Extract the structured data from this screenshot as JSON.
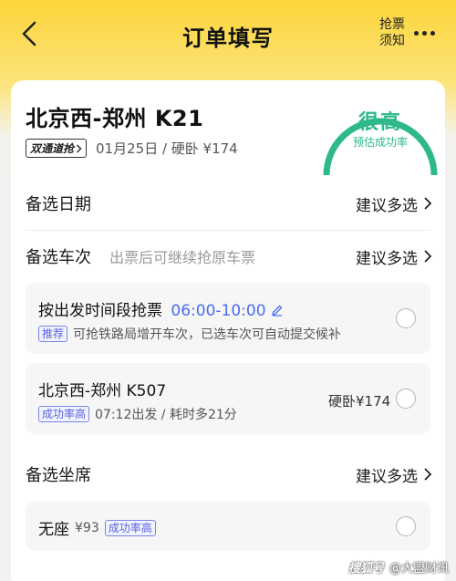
{
  "nav": {
    "title": "订单填写",
    "notice_line1": "抢票",
    "notice_line2": "须知"
  },
  "train": {
    "route": "北京西-郑州 K21",
    "tag": "双通道抢",
    "info": "01月25日 / 硬卧 ¥174"
  },
  "success_gauge": {
    "value": "很高",
    "label": "预估成功率",
    "color": "#2fb88c"
  },
  "alt_date": {
    "label": "备选日期",
    "action": "建议多选"
  },
  "alt_train": {
    "label": "备选车次",
    "hint": "出票后可继续抢原车票",
    "action": "建议多选",
    "options": [
      {
        "title": "按出发时间段抢票",
        "time_range": "06:00-10:00",
        "badge": "推荐",
        "desc": "可抢铁路局增开车次，已选车次可自动提交候补"
      },
      {
        "title": "北京西-郑州 K507",
        "badge": "成功率高",
        "desc": "07:12出发 / 耗时多21分",
        "price": "硬卧¥174"
      }
    ]
  },
  "alt_seat": {
    "label": "备选坐席",
    "action": "建议多选",
    "options": [
      {
        "title": "无座",
        "price": "¥93",
        "badge": "成功率高"
      }
    ]
  },
  "watermark": {
    "left": "搜狐号",
    "right": "@大盟财讯"
  },
  "colors": {
    "accent_blue": "#4a6cf0",
    "brand_yellow": "#fbd53a"
  }
}
